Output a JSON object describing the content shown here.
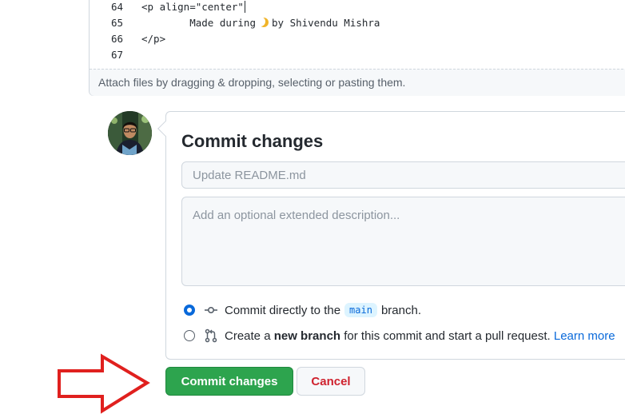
{
  "editor": {
    "lines": [
      {
        "num": "64",
        "text": "<p align=\"center\""
      },
      {
        "num": "65",
        "text": "        Made during",
        "emoji": "crescent-moon-icon",
        "text_after": "by Shivendu Mishra"
      },
      {
        "num": "66",
        "text": "</p>"
      },
      {
        "num": "67",
        "text": ""
      }
    ],
    "attach_hint": "Attach files by dragging & dropping, selecting or pasting them."
  },
  "commit": {
    "title": "Commit changes",
    "summary_placeholder": "Update README.md",
    "description_placeholder": "Add an optional extended description...",
    "option_direct": {
      "prefix": "Commit directly to the",
      "branch": "main",
      "suffix": "branch."
    },
    "option_new_branch": {
      "prefix": "Create a",
      "bold": "new branch",
      "suffix": "for this commit and start a pull request.",
      "link": "Learn more"
    }
  },
  "buttons": {
    "commit_label": "Commit changes",
    "cancel_label": "Cancel"
  },
  "colors": {
    "commit_button": "#2da44e",
    "cancel_text": "#cf222e",
    "link": "#0969da",
    "annotation_arrow": "#e0201e"
  }
}
